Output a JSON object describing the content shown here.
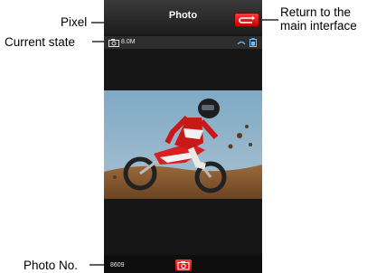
{
  "app": {
    "title": "Photo"
  },
  "status": {
    "resolution": "8.0M",
    "photo_number": "8609"
  },
  "annotations": {
    "pixel": "Pixel",
    "current_state": "Current state",
    "return_line1": "Return to the",
    "return_line2": "main interface",
    "photo_no": "Photo No."
  },
  "icons": {
    "mode": "camera-mode-icon",
    "return": "return-arrow-icon",
    "shutter": "camera-shutter-icon",
    "battery": "battery-icon",
    "signal": "signal-icon"
  },
  "colors": {
    "accent_red": "#e01010",
    "bar": "#2d2d2d",
    "background": "#161616"
  }
}
